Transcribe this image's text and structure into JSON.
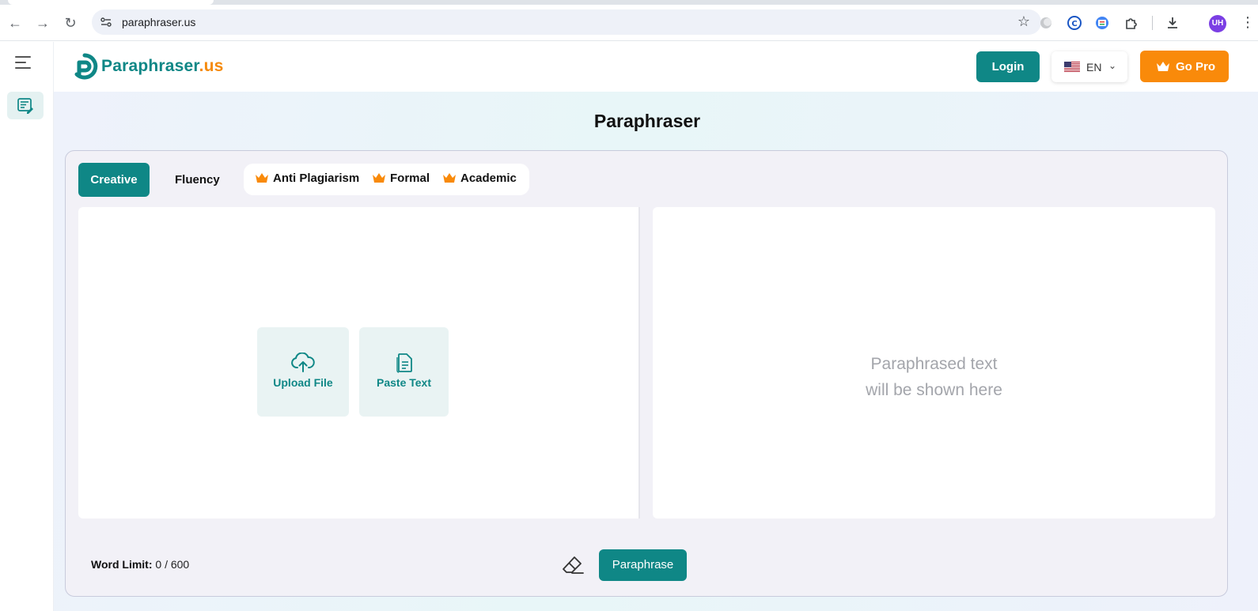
{
  "browser": {
    "url": "paraphraser.us",
    "avatar_initials": "UH"
  },
  "header": {
    "logo_main": "Paraphraser",
    "logo_tld": ".us",
    "login_label": "Login",
    "language_code": "EN",
    "go_pro_label": "Go Pro"
  },
  "page": {
    "title": "Paraphraser"
  },
  "modes": {
    "active": "Creative",
    "fluency": "Fluency",
    "premium": [
      "Anti Plagiarism",
      "Formal",
      "Academic"
    ]
  },
  "input": {
    "upload_label": "Upload File",
    "paste_label": "Paste Text"
  },
  "output": {
    "placeholder_line1": "Paraphrased text",
    "placeholder_line2": "will be shown here"
  },
  "footer": {
    "word_limit_label": "Word Limit",
    "word_limit_value": "0 / 600",
    "paraphrase_label": "Paraphrase"
  },
  "colors": {
    "brand": "#0f8786",
    "accent": "#f98a0a",
    "placeholder": "#a3a5ab"
  },
  "icons": {
    "sidebar_menu": "hamburger-icon",
    "sidebar_tool": "paraphrase-tool-icon",
    "premium": "crown-icon",
    "upload": "cloud-upload-icon",
    "paste": "document-icon",
    "clear": "eraser-icon"
  }
}
